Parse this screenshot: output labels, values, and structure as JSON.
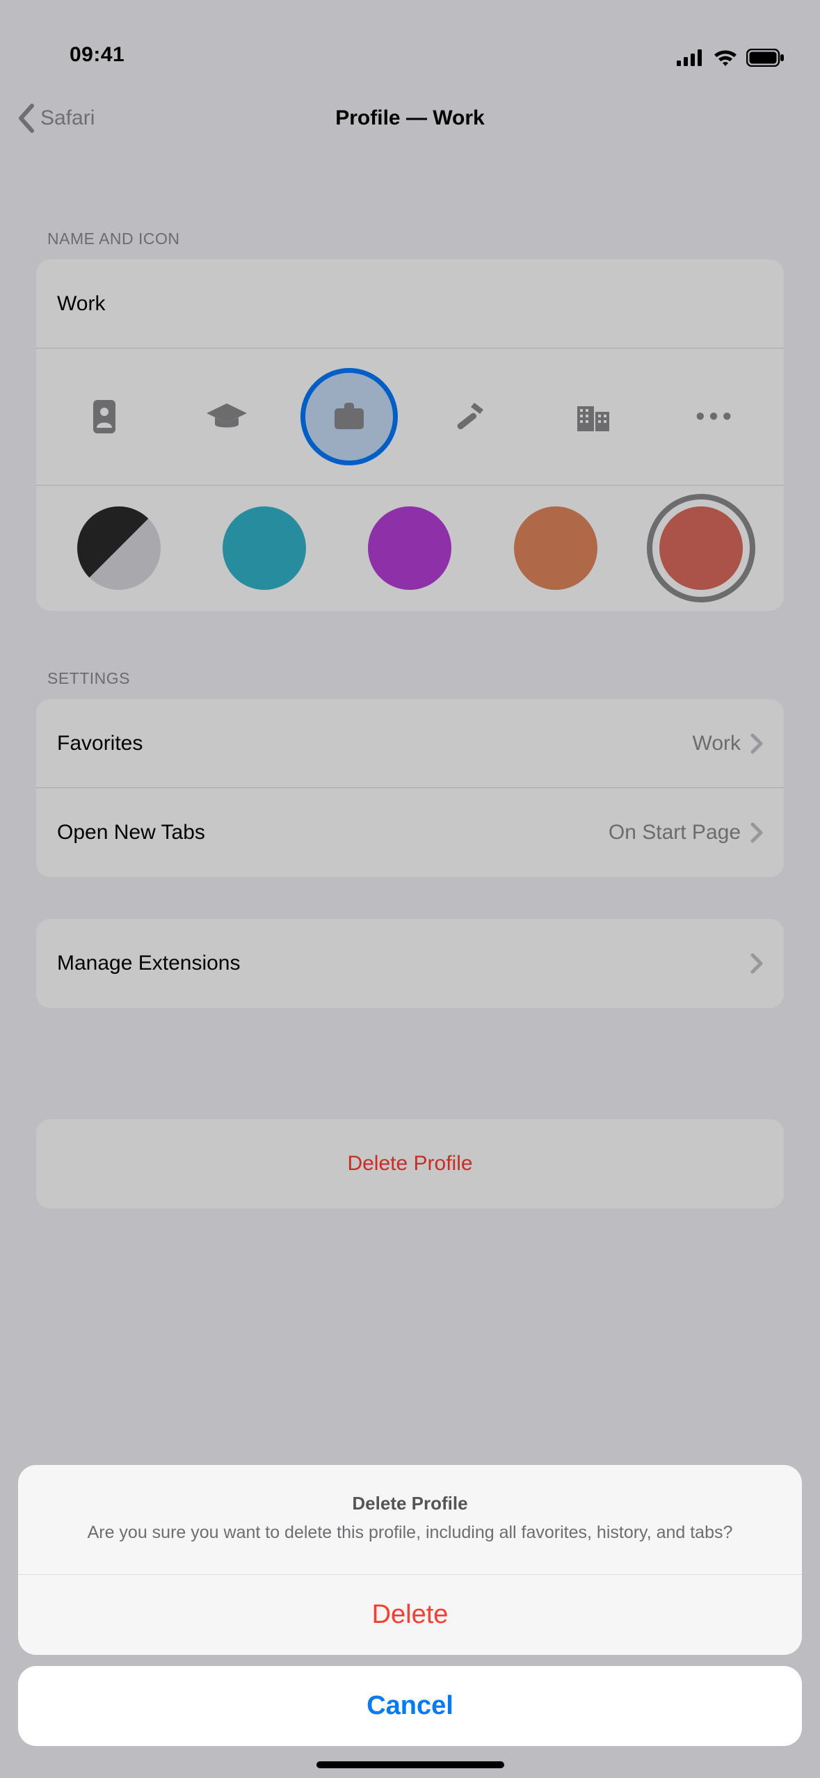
{
  "status": {
    "time": "09:41"
  },
  "nav": {
    "back_label": "Safari",
    "title": "Profile — Work"
  },
  "sections": {
    "name_and_icon_header": "NAME AND ICON",
    "settings_header": "SETTINGS"
  },
  "profile": {
    "name": "Work",
    "icons": [
      {
        "id": "badge-icon",
        "selected": false
      },
      {
        "id": "graduation-icon",
        "selected": false
      },
      {
        "id": "briefcase-icon",
        "selected": true
      },
      {
        "id": "hammer-icon",
        "selected": false
      },
      {
        "id": "building-icon",
        "selected": false
      },
      {
        "id": "more-icon",
        "selected": false
      }
    ],
    "colors": [
      {
        "id": "default-color",
        "hex": "two-tone",
        "selected": false
      },
      {
        "id": "teal-color",
        "hex": "#33b4cc",
        "selected": false
      },
      {
        "id": "purple-color",
        "hex": "#b63fd8",
        "selected": false
      },
      {
        "id": "orange-color",
        "hex": "#e0875d",
        "selected": false
      },
      {
        "id": "coral-color",
        "hex": "#dd6a5e",
        "selected": true
      }
    ]
  },
  "settings": {
    "favorites_label": "Favorites",
    "favorites_value": "Work",
    "new_tabs_label": "Open New Tabs",
    "new_tabs_value": "On Start Page",
    "manage_extensions_label": "Manage Extensions",
    "delete_profile_label": "Delete Profile"
  },
  "sheet": {
    "title": "Delete Profile",
    "message": "Are you sure you want to delete this profile, including all favorites, history, and tabs?",
    "delete_label": "Delete",
    "cancel_label": "Cancel"
  }
}
